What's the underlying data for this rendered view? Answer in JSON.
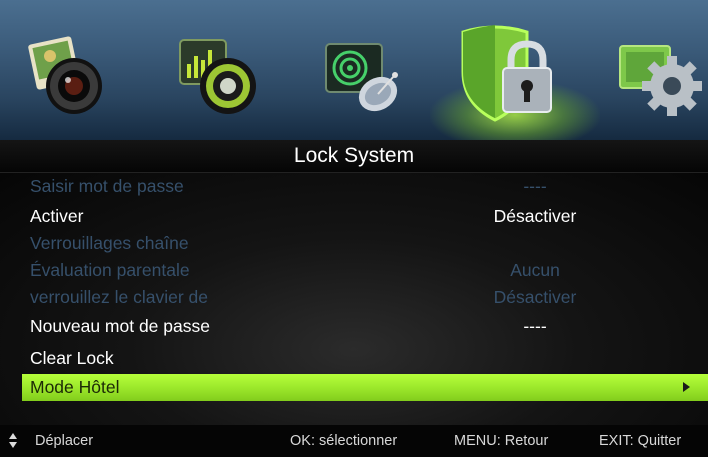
{
  "icons": [
    "picture-camera-icon",
    "music-speaker-icon",
    "satellite-dish-icon",
    "lock-shield-icon",
    "settings-gear-icon"
  ],
  "title": "Lock System",
  "menu": {
    "items": [
      {
        "label": "Saisir mot de passe",
        "value": "----",
        "state": "dim"
      },
      {
        "label": "Activer",
        "value": "Désactiver",
        "state": "on"
      },
      {
        "label": "Verrouillages chaîne",
        "value": "",
        "state": "dim"
      },
      {
        "label": "Évaluation parentale",
        "value": "Aucun",
        "state": "dim"
      },
      {
        "label": "verrouillez le clavier de",
        "value": "Désactiver",
        "state": "dim"
      },
      {
        "label": "Nouveau mot de passe",
        "value": "----",
        "state": "on"
      },
      {
        "label": "Clear Lock",
        "value": "",
        "state": "on"
      },
      {
        "label": "Mode Hôtel",
        "value": "",
        "state": "selected"
      }
    ]
  },
  "footer": {
    "move": "Déplacer",
    "ok": "OK: sélectionner",
    "menu": "MENU: Retour",
    "exit": "EXIT: Quitter"
  },
  "colors": {
    "highlight": "#9ae62a",
    "dim_text": "#36506b",
    "active_text": "#ffffff"
  }
}
